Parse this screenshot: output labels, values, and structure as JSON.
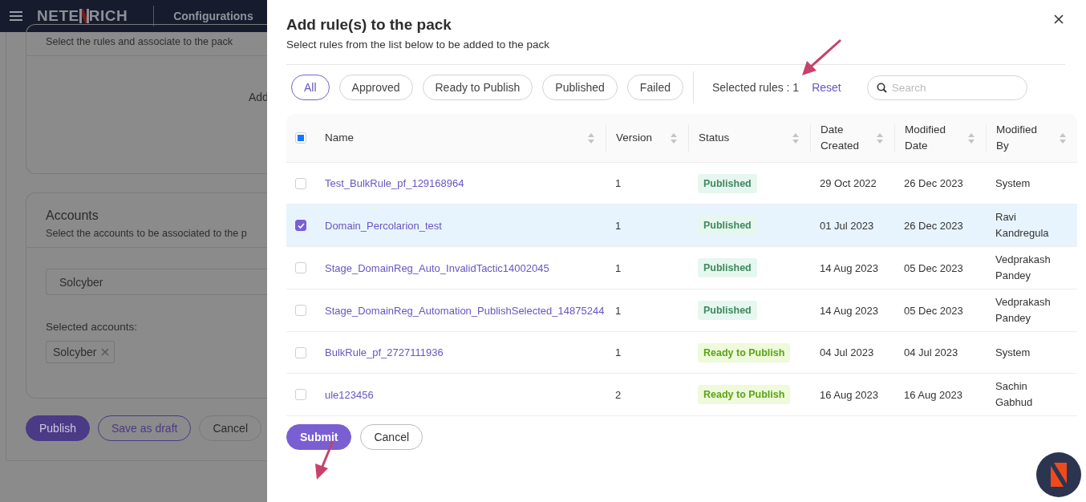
{
  "header": {
    "logo_left": "NETE",
    "logo_right": "RICH",
    "section": "Configurations"
  },
  "rules_card": {
    "subtitle": "Select the rules and associate to the pack",
    "body_text": "Add"
  },
  "accounts_card": {
    "title": "Accounts",
    "subtitle": "Select the accounts to be associated to the p",
    "select_value": "Solcyber",
    "selected_label": "Selected accounts:",
    "chips": [
      "Solcyber"
    ]
  },
  "page_buttons": [
    {
      "label": "Publish",
      "kind": "primary"
    },
    {
      "label": "Save as draft",
      "kind": "outline"
    },
    {
      "label": "Cancel",
      "kind": "plain"
    }
  ],
  "drawer": {
    "title": "Add rule(s) to the pack",
    "subtitle": "Select rules from the list below to be added to the pack",
    "filters": [
      {
        "label": "All",
        "selected": true
      },
      {
        "label": "Approved",
        "selected": false
      },
      {
        "label": "Ready to Publish",
        "selected": false
      },
      {
        "label": "Published",
        "selected": false
      },
      {
        "label": "Failed",
        "selected": false
      }
    ],
    "selected_count": "Selected rules : 1",
    "reset": "Reset",
    "search": {
      "placeholder": "Search"
    },
    "table": {
      "select_all": {
        "indeterminate": true
      },
      "columns": [
        "Name",
        "Version",
        "Status",
        "Date Created",
        "Modified Date",
        "Modified By"
      ],
      "rows": [
        {
          "selected": false,
          "name": "Test_BulkRule_pf_129168964",
          "version": "1",
          "status": {
            "text": "Published",
            "kind": "published"
          },
          "date_created": "29 Oct 2022",
          "modified_date": "26 Dec 2023",
          "modified_by": "System"
        },
        {
          "selected": true,
          "name": "Domain_Percolarion_test",
          "version": "1",
          "status": {
            "text": "Published",
            "kind": "published"
          },
          "date_created": "01 Jul 2023",
          "modified_date": "26 Dec 2023",
          "modified_by": "Ravi Kandregula"
        },
        {
          "selected": false,
          "name": "Stage_DomainReg_Auto_InvalidTactic14002045",
          "version": "1",
          "status": {
            "text": "Published",
            "kind": "published"
          },
          "date_created": "14 Aug 2023",
          "modified_date": "05 Dec 2023",
          "modified_by": "Vedprakash Pandey"
        },
        {
          "selected": false,
          "name": "Stage_DomainReg_Automation_PublishSelected_14875244",
          "version": "1",
          "status": {
            "text": "Published",
            "kind": "published"
          },
          "date_created": "14 Aug 2023",
          "modified_date": "05 Dec 2023",
          "modified_by": "Vedprakash Pandey"
        },
        {
          "selected": false,
          "name": "BulkRule_pf_2727111936",
          "version": "1",
          "status": {
            "text": "Ready to Publish",
            "kind": "ready"
          },
          "date_created": "04 Jul 2023",
          "modified_date": "04 Jul 2023",
          "modified_by": "System"
        },
        {
          "selected": false,
          "name": "ule123456",
          "version": "2",
          "status": {
            "text": "Ready to Publish",
            "kind": "ready"
          },
          "date_created": "16 Aug 2023",
          "modified_date": "16 Aug 2023",
          "modified_by": "Sachin Gabhud"
        }
      ]
    },
    "buttons": [
      {
        "label": "Submit",
        "kind": "primary"
      },
      {
        "label": "Cancel",
        "kind": "plain"
      }
    ]
  }
}
